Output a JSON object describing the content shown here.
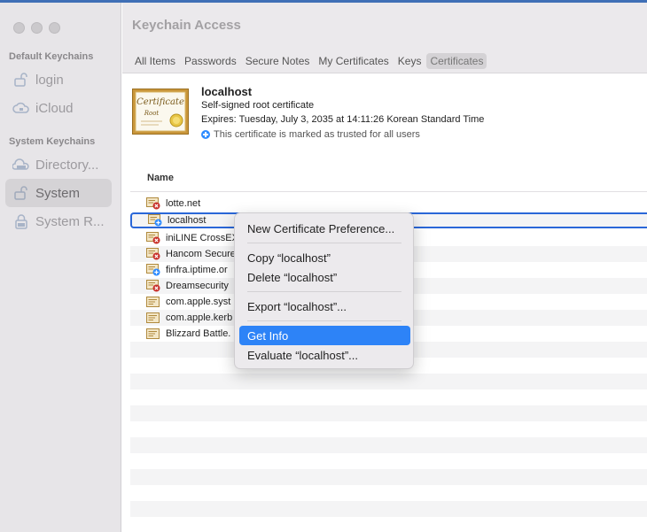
{
  "window": {
    "title": "Keychain Access"
  },
  "sidebar": {
    "sections": [
      {
        "heading": "Default Keychains",
        "items": [
          {
            "label": "login",
            "icon": "unlocked-lock-icon"
          },
          {
            "label": "iCloud",
            "icon": "cloud-icon"
          }
        ]
      },
      {
        "heading": "System Keychains",
        "items": [
          {
            "label": "Directory...",
            "icon": "directory-icon"
          },
          {
            "label": "System",
            "icon": "unlocked-lock-icon",
            "selected": true
          },
          {
            "label": "System R...",
            "icon": "locked-lock-icon"
          }
        ]
      }
    ]
  },
  "tabs": [
    {
      "label": "All Items"
    },
    {
      "label": "Passwords"
    },
    {
      "label": "Secure Notes"
    },
    {
      "label": "My Certificates"
    },
    {
      "label": "Keys"
    },
    {
      "label": "Certificates",
      "active": true
    }
  ],
  "detail": {
    "name": "localhost",
    "kind": "Self-signed root certificate",
    "expires": "Expires: Tuesday, July 3, 2035 at 14:11:26 Korean Standard Time",
    "trust": "This certificate is marked as trusted for all users",
    "icon_text_line1": "Certificate",
    "icon_text_line2": "Root"
  },
  "list": {
    "column": "Name",
    "rows": [
      {
        "name": "lotte.net",
        "status": "invalid"
      },
      {
        "name": "localhost",
        "status": "trusted",
        "selected": true
      },
      {
        "name": "iniLINE CrossEX",
        "status": "invalid"
      },
      {
        "name": "Hancom Secure",
        "status": "invalid"
      },
      {
        "name": "finfra.iptime.or",
        "status": "trusted"
      },
      {
        "name": "Dreamsecurity",
        "status": "invalid"
      },
      {
        "name": "com.apple.syst",
        "status": "normal"
      },
      {
        "name": "com.apple.kerb",
        "status": "normal"
      },
      {
        "name": "Blizzard Battle.",
        "status": "normal"
      }
    ]
  },
  "context_menu": {
    "items": [
      {
        "label": "New Certificate Preference..."
      },
      {
        "separator": true
      },
      {
        "label": "Copy “localhost”"
      },
      {
        "label": "Delete “localhost”"
      },
      {
        "separator": true
      },
      {
        "label": "Export “localhost”..."
      },
      {
        "separator": true
      },
      {
        "label": "Get Info",
        "highlighted": true
      },
      {
        "label": "Evaluate “localhost”..."
      }
    ]
  },
  "colors": {
    "accent": "#2d83f7",
    "selection_outline": "#2a67d8",
    "invalid": "#c8312b",
    "trusted": "#2f8cff"
  }
}
